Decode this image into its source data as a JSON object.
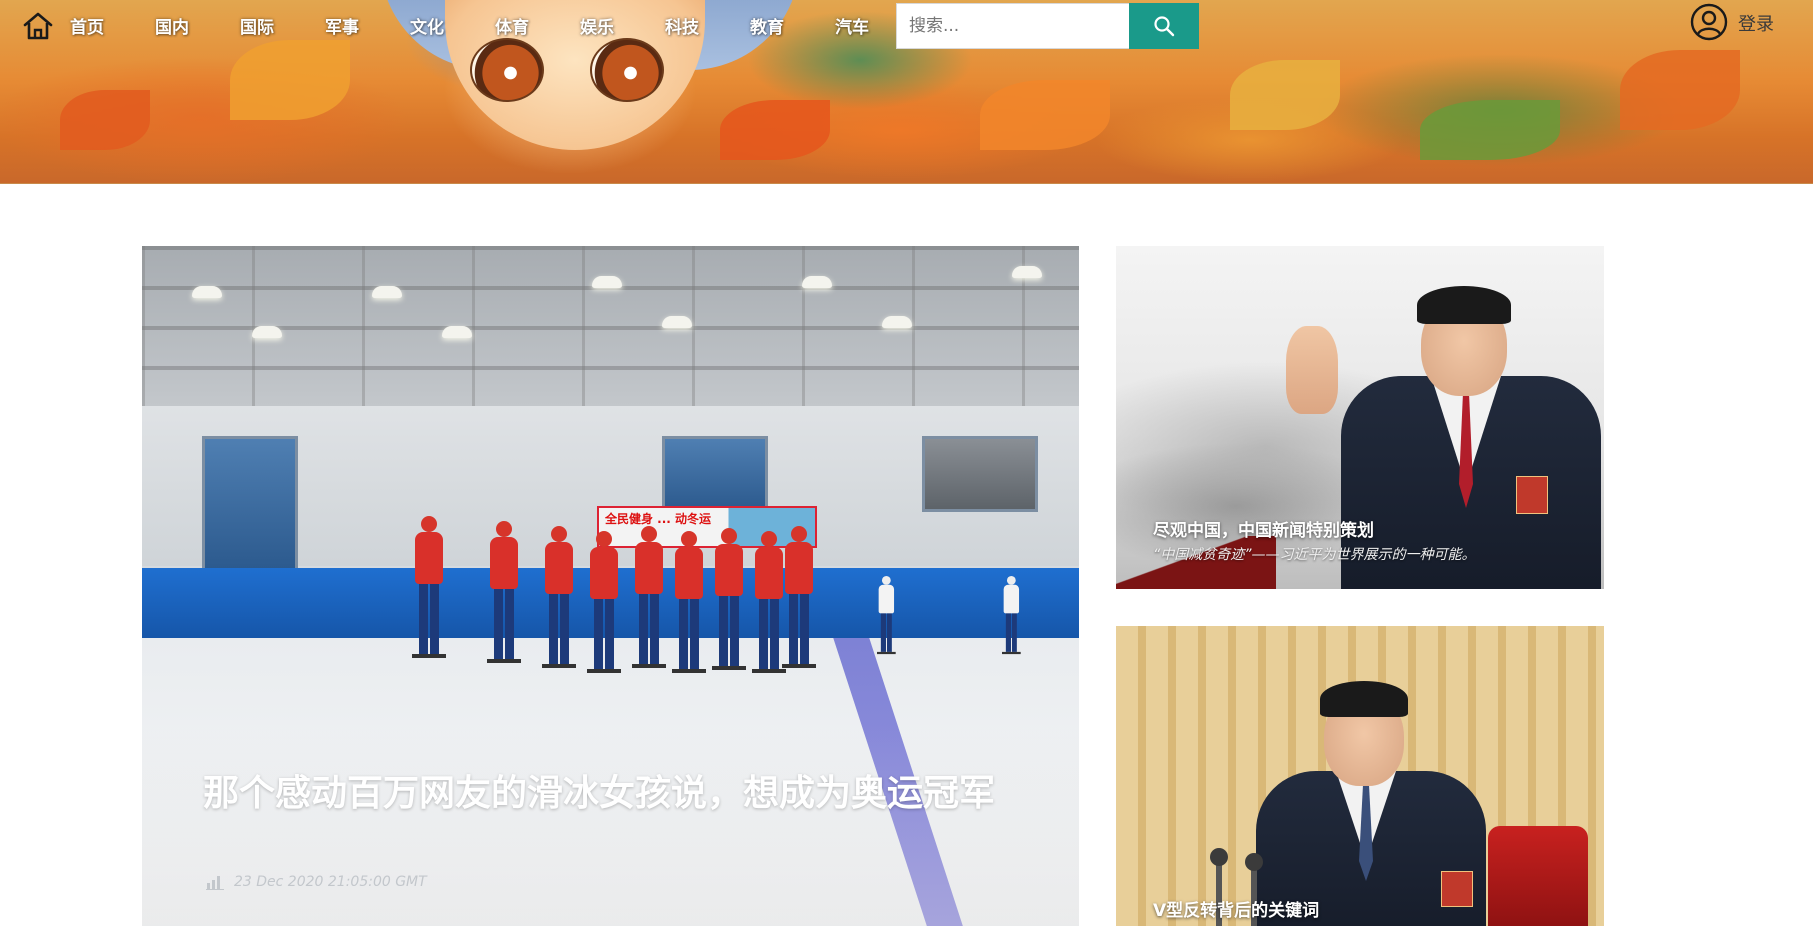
{
  "nav": {
    "home_icon": "home-icon",
    "items": [
      {
        "label": "首页"
      },
      {
        "label": "国内"
      },
      {
        "label": "国际"
      },
      {
        "label": "军事"
      },
      {
        "label": "文化"
      },
      {
        "label": "体育"
      },
      {
        "label": "娱乐"
      },
      {
        "label": "科技"
      },
      {
        "label": "教育"
      },
      {
        "label": "汽车"
      }
    ]
  },
  "search": {
    "placeholder": "搜索...",
    "button_icon": "search-icon",
    "button_color": "#1a9a8a"
  },
  "user": {
    "icon": "user-icon",
    "login_label": "登录"
  },
  "main_story": {
    "title": "那个感动百万网友的滑冰女孩说，想成为奥运冠军",
    "timestamp": "23 Dec 2020 21:05:00 GMT",
    "meta_icon": "bar-chart-icon",
    "photo_sign_text": "全民健身 ... 动冬运"
  },
  "side_stories": [
    {
      "title": "尽观中国，中国新闻特别策划",
      "subtitle": "“中国减贫奇迹”——习近平为世界展示的一种可能。"
    },
    {
      "title": "V型反转背后的关键词"
    }
  ]
}
